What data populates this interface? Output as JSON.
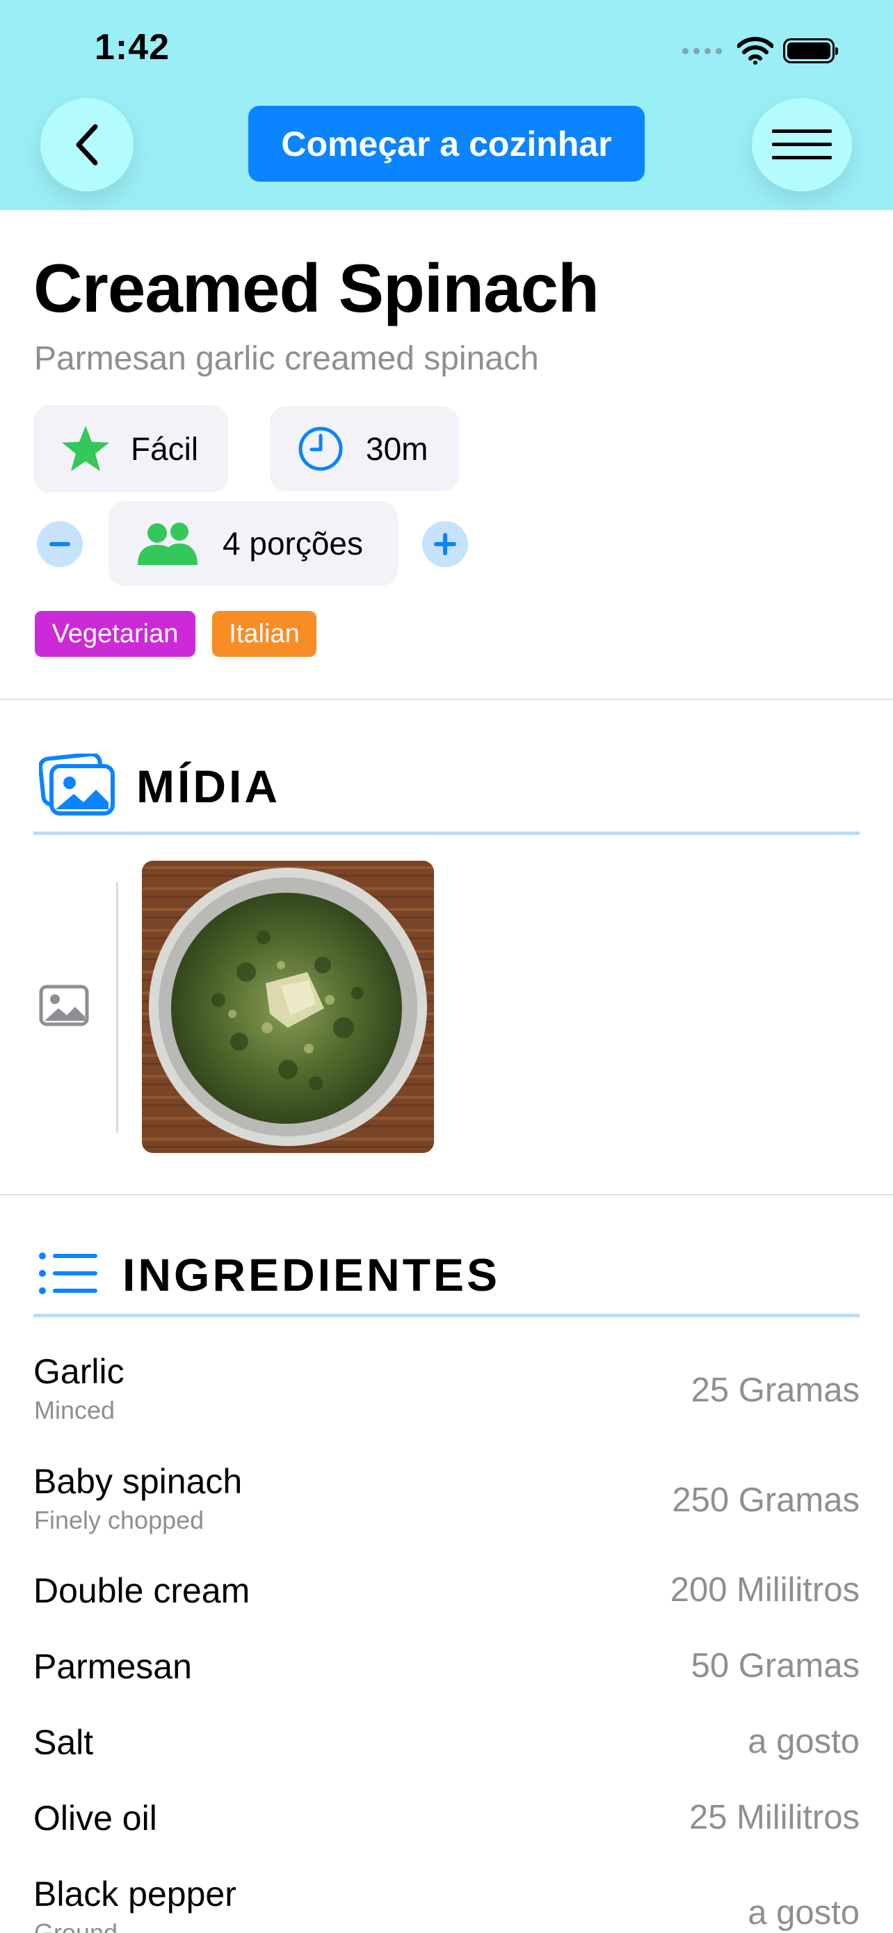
{
  "status_bar": {
    "time": "1:42"
  },
  "header": {
    "cook_button": "Começar a cozinhar"
  },
  "recipe": {
    "title": "Creamed Spinach",
    "subtitle": "Parmesan garlic creamed spinach",
    "difficulty": "Fácil",
    "time": "30m",
    "servings": "4 porções",
    "tags": [
      {
        "label": "Vegetarian",
        "color": "#cc2ad8"
      },
      {
        "label": "Italian",
        "color": "#f98d25"
      }
    ]
  },
  "media": {
    "title": "MÍDIA"
  },
  "ingredients": {
    "title": "INGREDIENTES",
    "items": [
      {
        "name": "Garlic",
        "note": "Minced",
        "qty": "25 Gramas"
      },
      {
        "name": "Baby spinach",
        "note": "Finely chopped",
        "qty": "250 Gramas"
      },
      {
        "name": "Double cream",
        "note": "",
        "qty": "200 Mililitros"
      },
      {
        "name": "Parmesan",
        "note": "",
        "qty": "50 Gramas"
      },
      {
        "name": "Salt",
        "note": "",
        "qty": "a gosto"
      },
      {
        "name": "Olive oil",
        "note": "",
        "qty": "25 Mililitros"
      },
      {
        "name": "Black pepper",
        "note": "Ground",
        "qty": "a gosto"
      }
    ]
  },
  "colors": {
    "header_bg": "#9aeef5",
    "accent": "#0a84ff",
    "star": "#34c759",
    "section_rule": "#b9dcf8"
  }
}
